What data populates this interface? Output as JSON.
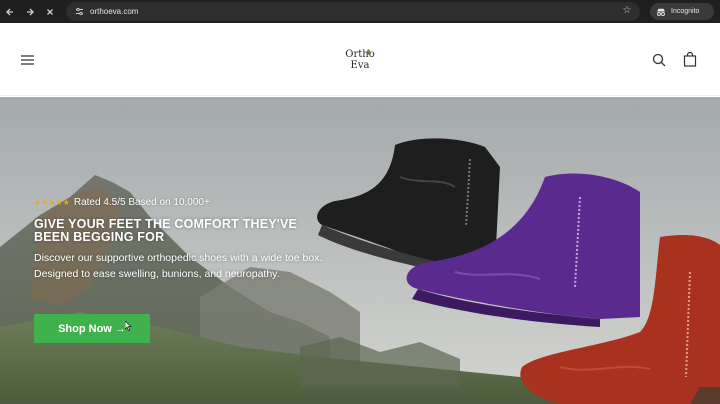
{
  "browser": {
    "url": "orthoeva.com",
    "incognito_label": "Incognito",
    "bar_color": "#1f1f1f"
  },
  "header": {
    "logo_line1": "Ortho",
    "logo_line2": "Eva"
  },
  "hero": {
    "stars": "★★★★★",
    "rating_text": "Rated 4.5/5 Based on 10,000+",
    "headline": "GIVE YOUR FEET THE COMFORT THEY'VE BEEN BEGGING FOR",
    "subtext": "Discover our supportive orthopedic shoes with a wide toe box. Designed to ease swelling, bunions, and neuropathy.",
    "cta_label": "Shop Now →",
    "cta_color": "#3fb14d",
    "boot_colors": [
      "#1e1e1e",
      "#5b2a8f",
      "#a8321f"
    ]
  },
  "icons": {
    "back": "back-arrow-icon",
    "forward": "forward-arrow-icon",
    "stop": "stop-loading-icon",
    "site_info": "site-info-icon",
    "bookmark": "bookmark-star-icon",
    "incognito": "incognito-icon",
    "menu": "hamburger-menu-icon",
    "search": "search-icon",
    "cart": "shopping-bag-icon"
  }
}
